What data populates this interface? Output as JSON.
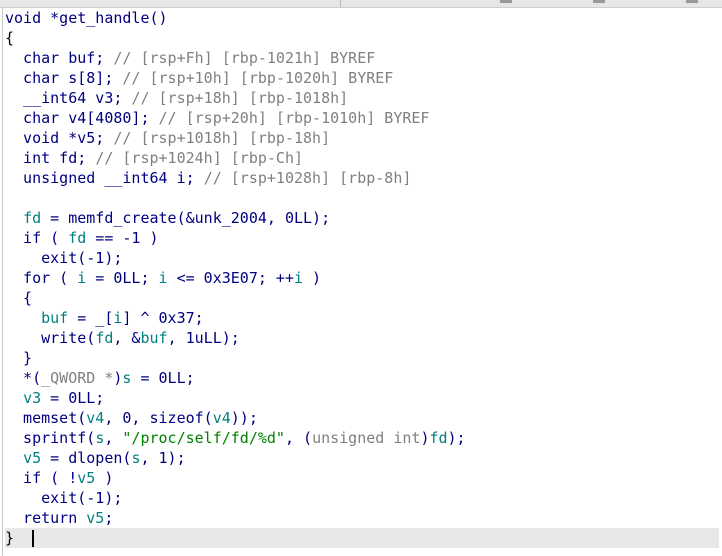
{
  "editor": {
    "lines": [
      [
        [
          "k",
          "void *get_handle()"
        ]
      ],
      [
        [
          "p",
          "{"
        ]
      ],
      [
        [
          "k",
          "  char buf; "
        ],
        [
          "c",
          "// [rsp+Fh] [rbp-1021h] BYREF"
        ]
      ],
      [
        [
          "k",
          "  char s[8]; "
        ],
        [
          "c",
          "// [rsp+10h] [rbp-1020h] BYREF"
        ]
      ],
      [
        [
          "k",
          "  __int64 v3; "
        ],
        [
          "c",
          "// [rsp+18h] [rbp-1018h]"
        ]
      ],
      [
        [
          "k",
          "  char v4[4080]; "
        ],
        [
          "c",
          "// [rsp+20h] [rbp-1010h] BYREF"
        ]
      ],
      [
        [
          "k",
          "  void *v5; "
        ],
        [
          "c",
          "// [rsp+1018h] [rbp-18h]"
        ]
      ],
      [
        [
          "k",
          "  int fd; "
        ],
        [
          "c",
          "// [rsp+1024h] [rbp-Ch]"
        ]
      ],
      [
        [
          "k",
          "  unsigned __int64 i; "
        ],
        [
          "c",
          "// [rsp+1028h] [rbp-8h]"
        ]
      ],
      [
        [
          "k",
          ""
        ]
      ],
      [
        [
          "k",
          "  "
        ],
        [
          "v",
          "fd"
        ],
        [
          "k",
          " = memfd_create(&unk_2004, 0LL);"
        ]
      ],
      [
        [
          "k",
          "  if ( "
        ],
        [
          "v",
          "fd"
        ],
        [
          "k",
          " == -1 )"
        ]
      ],
      [
        [
          "k",
          "    exit(-1);"
        ]
      ],
      [
        [
          "k",
          "  for ( "
        ],
        [
          "v",
          "i"
        ],
        [
          "k",
          " = 0LL; "
        ],
        [
          "v",
          "i"
        ],
        [
          "k",
          " <= 0x3E07; ++"
        ],
        [
          "v",
          "i"
        ],
        [
          "k",
          " )"
        ]
      ],
      [
        [
          "k",
          "  {"
        ]
      ],
      [
        [
          "k",
          "    "
        ],
        [
          "v",
          "buf"
        ],
        [
          "k",
          " = _["
        ],
        [
          "v",
          "i"
        ],
        [
          "k",
          "] ^ 0x37;"
        ]
      ],
      [
        [
          "k",
          "    write("
        ],
        [
          "v",
          "fd"
        ],
        [
          "k",
          ", &"
        ],
        [
          "v",
          "buf"
        ],
        [
          "k",
          ", 1uLL);"
        ]
      ],
      [
        [
          "k",
          "  }"
        ]
      ],
      [
        [
          "k",
          "  *("
        ],
        [
          "c",
          "_QWORD *"
        ],
        [
          "k",
          ")"
        ],
        [
          "v",
          "s"
        ],
        [
          "k",
          " = 0LL;"
        ]
      ],
      [
        [
          "k",
          "  "
        ],
        [
          "v",
          "v3"
        ],
        [
          "k",
          " = 0LL;"
        ]
      ],
      [
        [
          "k",
          "  memset("
        ],
        [
          "v",
          "v4"
        ],
        [
          "k",
          ", 0, sizeof("
        ],
        [
          "v",
          "v4"
        ],
        [
          "k",
          "));"
        ]
      ],
      [
        [
          "k",
          "  sprintf("
        ],
        [
          "v",
          "s"
        ],
        [
          "k",
          ", "
        ],
        [
          "s",
          "\"/proc/self/fd/%d\""
        ],
        [
          "k",
          ", ("
        ],
        [
          "c",
          "unsigned int"
        ],
        [
          "k",
          ")"
        ],
        [
          "v",
          "fd"
        ],
        [
          "k",
          ");"
        ]
      ],
      [
        [
          "k",
          "  "
        ],
        [
          "v",
          "v5"
        ],
        [
          "k",
          " = dlopen("
        ],
        [
          "v",
          "s"
        ],
        [
          "k",
          ", 1);"
        ]
      ],
      [
        [
          "k",
          "  if ( !"
        ],
        [
          "v",
          "v5"
        ],
        [
          "k",
          " )"
        ]
      ],
      [
        [
          "k",
          "    exit(-1);"
        ]
      ],
      [
        [
          "k",
          "  return "
        ],
        [
          "v",
          "v5"
        ],
        [
          "k",
          ";"
        ]
      ],
      [
        [
          "p",
          "}"
        ]
      ]
    ],
    "current_line": 26
  }
}
